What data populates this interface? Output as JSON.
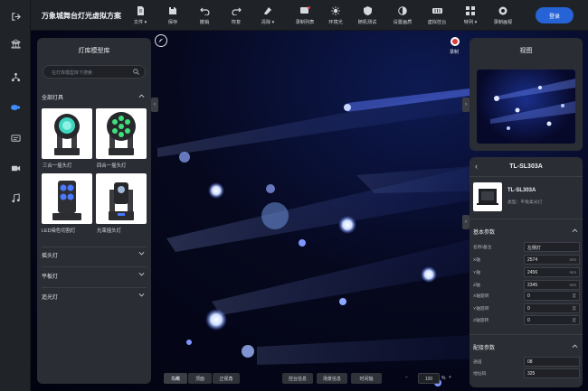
{
  "app": {
    "title": "万象城舞台灯光虚拟方案"
  },
  "rail": {
    "items": [
      {
        "icon": "exit-icon"
      },
      {
        "icon": "theater-icon"
      },
      {
        "icon": "network-icon"
      },
      {
        "icon": "lamp-icon"
      },
      {
        "icon": "screen-icon"
      },
      {
        "icon": "camera-icon"
      },
      {
        "icon": "music-icon"
      }
    ]
  },
  "toolbar": {
    "file": "文件",
    "save": "保存",
    "undo": "撤销",
    "redo": "恢复",
    "clear": "清除",
    "record_list": "录制列表",
    "ambient": "环境光",
    "random_test": "随机测试",
    "effects": "设置画质",
    "virtual_console": "虚拟控台",
    "special": "特列",
    "record_view": "录制画视",
    "login": "登录"
  },
  "stage": {
    "record_label": "录制"
  },
  "library": {
    "title": "灯库模型库",
    "search_placeholder": "在灯库模型库下搜索",
    "section_all": "全部灯具",
    "items": [
      {
        "label": "三合一摇头灯"
      },
      {
        "label": "四合一摇头灯"
      },
      {
        "label": "LED染色切割灯"
      },
      {
        "label": "光束摇头灯"
      }
    ],
    "section_moving": "摇头灯",
    "section_flat": "平板灯",
    "section_follow": "追光灯"
  },
  "view_panel": {
    "title": "视图"
  },
  "properties": {
    "header": "TL-SL303A",
    "model_name": "TL-SL303A",
    "model_type": "类型：平板柔光灯",
    "basic_title": "基本参数",
    "rows": [
      {
        "key": "名称/备注",
        "value": "左侧灯",
        "unit": ""
      },
      {
        "key": "X轴",
        "value": "2574",
        "unit": "mm"
      },
      {
        "key": "Y轴",
        "value": "2456",
        "unit": "mm"
      },
      {
        "key": "Z轴",
        "value": "2345",
        "unit": "mm"
      },
      {
        "key": "X轴旋转",
        "value": "0",
        "unit": "度"
      },
      {
        "key": "Y轴旋转",
        "value": "0",
        "unit": "度"
      },
      {
        "key": "Z轴旋转",
        "value": "0",
        "unit": "度"
      }
    ],
    "patch_title": "配接参数",
    "patch_rows": [
      {
        "key": "通道",
        "value": "08"
      },
      {
        "key": "地址码",
        "value": "325"
      }
    ]
  },
  "bottom": {
    "view_bird": "鸟瞰",
    "view_top": "顶面",
    "view_front": "正视角",
    "console_info": "控台信息",
    "scene_info": "场景信息",
    "timeline": "时间轴",
    "zoom": "100",
    "zoom_unit": "%"
  }
}
